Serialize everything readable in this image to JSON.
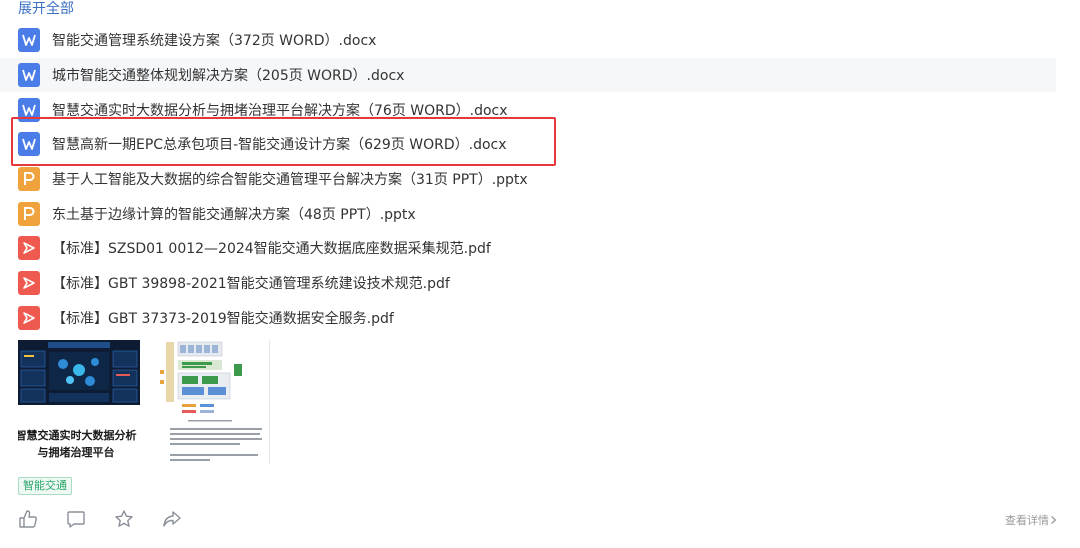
{
  "header": {
    "expand_all": "展开全部"
  },
  "files": [
    {
      "type": "word",
      "name": "智能交通管理系统建设方案（372页 WORD）.docx",
      "icon": "word-file-icon"
    },
    {
      "type": "word",
      "name": "城市智能交通整体规划解决方案（205页 WORD）.docx",
      "icon": "word-file-icon"
    },
    {
      "type": "word",
      "name": "智慧交通实时大数据分析与拥堵治理平台解决方案（76页 WORD）.docx",
      "icon": "word-file-icon"
    },
    {
      "type": "word",
      "name": "智慧高新一期EPC总承包项目-智能交通设计方案（629页 WORD）.docx",
      "icon": "word-file-icon"
    },
    {
      "type": "ppt",
      "name": "基于人工智能及大数据的综合智能交通管理平台解决方案（31页 PPT）.pptx",
      "icon": "ppt-file-icon"
    },
    {
      "type": "ppt",
      "name": "东土基于边缘计算的智能交通解决方案（48页 PPT）.pptx",
      "icon": "ppt-file-icon"
    },
    {
      "type": "pdf",
      "name": "【标准】SZSD01 0012—2024智能交通大数据底座数据采集规范.pdf",
      "icon": "pdf-file-icon"
    },
    {
      "type": "pdf",
      "name": "【标准】GBT 39898-2021智能交通管理系统建设技术规范.pdf",
      "icon": "pdf-file-icon"
    },
    {
      "type": "pdf",
      "name": "【标准】GBT 37373-2019智能交通数据安全服务.pdf",
      "icon": "pdf-file-icon"
    }
  ],
  "thumbnails": {
    "first_caption_line1": "智慧交通实时大数据分析",
    "first_caption_line2": "与拥堵治理平台"
  },
  "tag": "智能交通",
  "actions": {
    "like_icon": "thumbs-up-icon",
    "comment_icon": "comment-icon",
    "favorite_icon": "star-icon",
    "share_icon": "share-icon"
  },
  "detail_link": "查看详情",
  "colors": {
    "word": "#4a7de8",
    "ppt": "#f0a33c",
    "pdf": "#ee5a4f",
    "highlight": "#e5383b",
    "link": "#3a6fc4",
    "tag": "#2aa56a"
  }
}
